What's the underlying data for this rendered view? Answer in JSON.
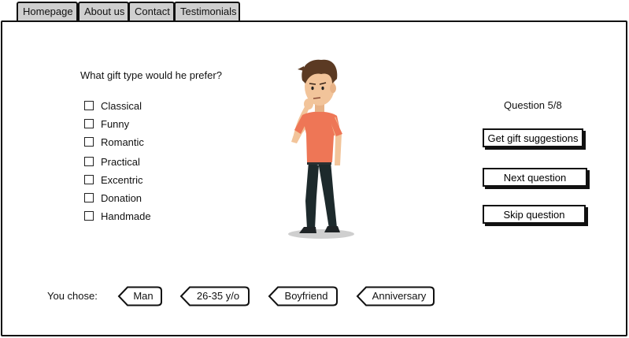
{
  "tabs": [
    "Homepage",
    "About us",
    "Contact",
    "Testimonials"
  ],
  "quiz": {
    "question": "What gift type would he prefer?",
    "options": [
      "Classical",
      "Funny",
      "Romantic",
      "Practical",
      "Excentric",
      "Donation",
      "Handmade"
    ],
    "progress": "Question 5/8"
  },
  "actions": {
    "suggestions": "Get gift suggestions",
    "next": "Next question",
    "skip": "Skip question"
  },
  "choices": {
    "label": "You chose:",
    "items": [
      "Man",
      "26-35 y/o",
      "Boyfriend",
      "Anniversary"
    ]
  }
}
